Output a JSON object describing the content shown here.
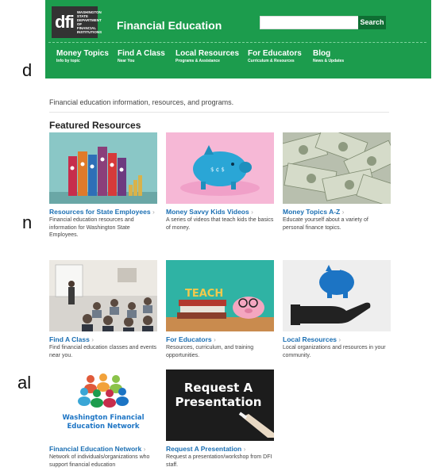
{
  "background_letters": [
    "d",
    "n",
    "al"
  ],
  "header": {
    "logo_text": "dfi",
    "logo_subtext": "WASHINGTON STATE DEPARTMENT OF FINANCIAL INSTITUTIONS",
    "title": "Financial Education",
    "search_value": "",
    "search_button": "Search"
  },
  "nav": [
    {
      "label": "Money Topics",
      "sub": "Info by topic"
    },
    {
      "label": "Find A Class",
      "sub": "Near You"
    },
    {
      "label": "Local Resources",
      "sub": "Programs & Assistance"
    },
    {
      "label": "For Educators",
      "sub": "Curriculum & Resources"
    },
    {
      "label": "Blog",
      "sub": "News & Updates"
    }
  ],
  "intro": "Financial education information, resources, and programs.",
  "featured_heading": "Featured Resources",
  "cards": [
    {
      "title": "Resources for State Employees",
      "desc": "Financial education resources and information for Washington State Employees."
    },
    {
      "title": "Money Savvy Kids Videos",
      "desc": "A series of videos that teach kids the basics of money."
    },
    {
      "title": "Money Topics A-Z",
      "desc": "Educate yourself about a variety of personal finance topics."
    },
    {
      "title": "Find A Class",
      "desc": "Find financial education classes and events near you."
    },
    {
      "title": "For Educators",
      "desc": "Resources, curriculum, and training opportunities."
    },
    {
      "title": "Local Resources",
      "desc": "Local organizations and resources in your community."
    },
    {
      "title": "Financial Education Network",
      "desc": "Network of individuals/organizations who support financial education"
    },
    {
      "title": "Request A Presentation",
      "desc": "Request a presentation/workshop from DFI staff."
    }
  ],
  "thumb_text": {
    "teach": "TEACH",
    "network_line1": "Washington Financial",
    "network_line2": "Education Network",
    "request_line1": "Request A",
    "request_line2": "Presentation"
  },
  "colors": {
    "header_green": "#1c9c4d",
    "link_blue": "#1b6fb3",
    "dark_green": "#0f6e33"
  }
}
